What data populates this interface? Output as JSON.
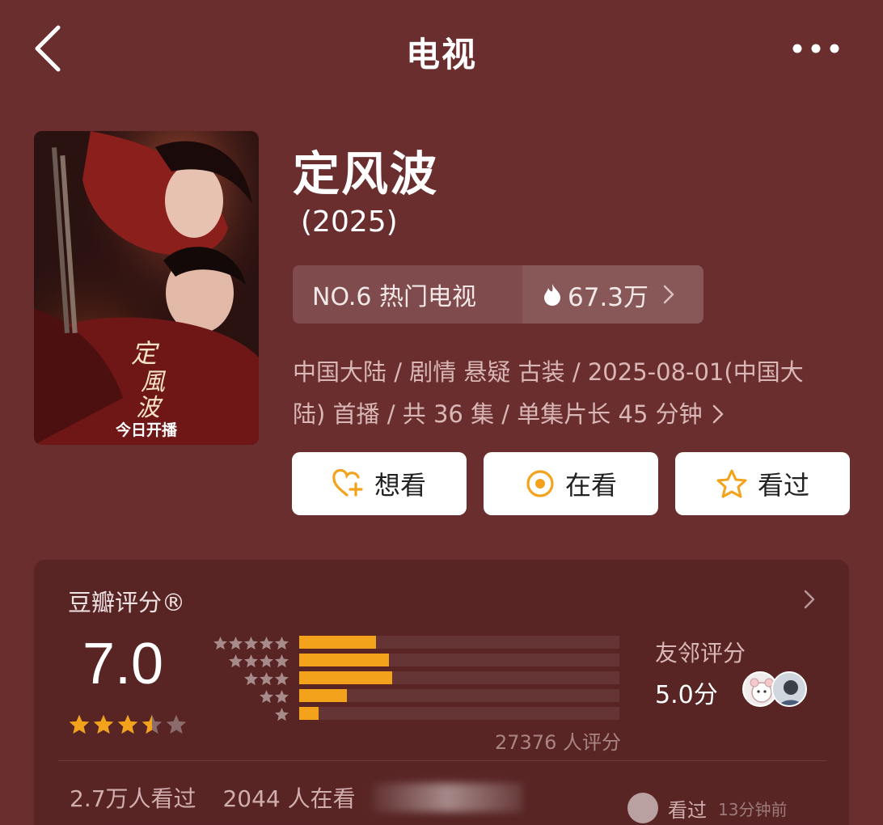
{
  "header": {
    "title": "电视"
  },
  "poster": {
    "logo_text": "定風波",
    "banner": "今日开播"
  },
  "show": {
    "title": "定风波",
    "year": "(2025)"
  },
  "rank": {
    "label": "NO.6 热门电视",
    "heat": "67.3万"
  },
  "meta": {
    "line1": "中国大陆 / 剧情 悬疑 古装 / 2025-08-01(中国大",
    "line2": "陆) 首播 / 共 36 集 / 单集片长 45 分钟"
  },
  "actions": {
    "want": "想看",
    "watching": "在看",
    "watched": "看过"
  },
  "rating": {
    "label": "豆瓣评分®",
    "score": "7.0",
    "stars": 3.5,
    "distribution": [
      {
        "stars": 5,
        "fraction": 0.24
      },
      {
        "stars": 4,
        "fraction": 0.28
      },
      {
        "stars": 3,
        "fraction": 0.29
      },
      {
        "stars": 2,
        "fraction": 0.15
      },
      {
        "stars": 1,
        "fraction": 0.06
      }
    ],
    "count": "27376 人评分",
    "friend_label": "友邻评分",
    "friend_score": "5.0分"
  },
  "stats": {
    "watched": "2.7万人看过",
    "watching": "2044 人在看"
  },
  "activity": {
    "action": "看过",
    "time": "13分钟前"
  },
  "colors": {
    "background": "#6b2e2f",
    "accent": "#f3a21b",
    "button_bg": "#ffffff"
  }
}
